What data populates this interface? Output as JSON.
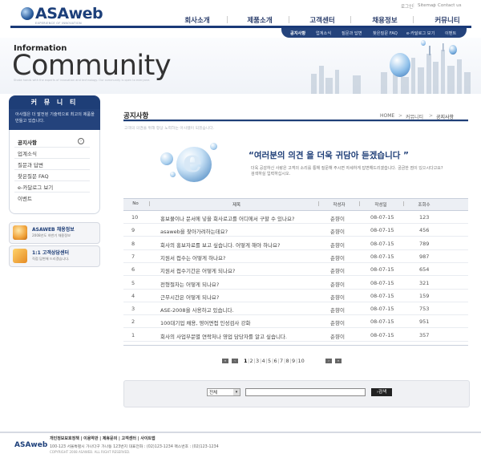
{
  "header": {
    "logo": "ASAweb",
    "logo_sub": "EXPERIENCE OF INNOVATION",
    "util": [
      "로그인",
      "Sitemap",
      "Contact us"
    ],
    "gnb": [
      "회사소개",
      "제품소개",
      "고객센터",
      "채용정보",
      "커뮤니티"
    ],
    "subnav": [
      "공지사항",
      "업계소식",
      "질문과 답변",
      "찾은질문 FAQ",
      "e-카달로그 보기",
      "이벤트"
    ]
  },
  "visual": {
    "info": "Information",
    "title": "Community",
    "desc": "Shake hands with the experts of innovation and technology. Our community is open to everyone."
  },
  "lnb": {
    "title": "커 뮤 니 티",
    "desc": "아사웹은 더 발전된 기술력으로 최고의 제품을 만들고 있습니다.",
    "items": [
      "공지사항",
      "업계소식",
      "질문과 답변",
      "찾은질문 FAQ",
      "e-카달로그 보기",
      "이벤트"
    ],
    "banners": [
      {
        "title": "ASAWEB 채용정보",
        "sub": "2008년도 하반기 채용정보"
      },
      {
        "title": "1:1 고객상담센터",
        "sub": "직접 답변해 드리겠습니다."
      }
    ]
  },
  "content": {
    "title": "공지사항",
    "breadcrumb": [
      "HOME",
      "커뮤니티",
      "공지사항"
    ],
    "desc": "고객의 의견을 위해 항상 노력하는 아사웹이 되겠습니다.",
    "quote": "“여러분의 의견 을 더욱 귀담아 듣겠습니다 ”",
    "quote_text": "더욱 공감하신 사랑은 고객의 소리를 통해 질문해 주시면 자세하게 답변해드리겠습니다. 궁금한 점이 있으시다고요? 검색하실 입력하십시오."
  },
  "table": {
    "headers": [
      "No",
      "제목",
      "작성자",
      "작성일",
      "조회수"
    ],
    "rows": [
      {
        "no": "10",
        "title": "홍보물이나 문서에 넣을 회사로고를 어디에서 구할 수 있나요?",
        "author": "춘향이",
        "date": "08-07-15",
        "views": "123"
      },
      {
        "no": "9",
        "title": "asaweb을 찾아가려하는데요?",
        "author": "춘향이",
        "date": "08-07-15",
        "views": "456"
      },
      {
        "no": "8",
        "title": "회사의 홍보자료를 보고 싶습니다. 어떻게 해야 하나요?",
        "author": "춘향이",
        "date": "08-07-15",
        "views": "789"
      },
      {
        "no": "7",
        "title": "지원서 접수는 어떻게 하나요?",
        "author": "춘향이",
        "date": "08-07-15",
        "views": "987"
      },
      {
        "no": "6",
        "title": "지원서 접수기간은 어떻게 되나요?",
        "author": "춘향이",
        "date": "08-07-15",
        "views": "654"
      },
      {
        "no": "5",
        "title": "전형절차는 어떻게 되나요?",
        "author": "춘향이",
        "date": "08-07-15",
        "views": "321"
      },
      {
        "no": "4",
        "title": "근무시간은 어떻게 되나요?",
        "author": "춘향이",
        "date": "08-07-15",
        "views": "159"
      },
      {
        "no": "3",
        "title": "ASE-2008을 사용하고 있습니다.",
        "author": "춘향이",
        "date": "08-07-15",
        "views": "753"
      },
      {
        "no": "2",
        "title": "100대기업 채용, 영어면접 인성검사 강화",
        "author": "춘향이",
        "date": "08-07-15",
        "views": "951"
      },
      {
        "no": "1",
        "title": "회사의 사업부문별 연락처나 영업 담당자를 알고 싶습니다.",
        "author": "춘향이",
        "date": "08-07-15",
        "views": "357"
      }
    ]
  },
  "pagination": {
    "pages": [
      "1",
      "2",
      "3",
      "4",
      "5",
      "6",
      "7",
      "8",
      "9",
      "10"
    ],
    "current": "1"
  },
  "search": {
    "select_value": "전체",
    "button": "검색"
  },
  "footer": {
    "logo": "ASAweb",
    "links": "개인정보보호정책 | 이용약관 | 제휴문의 | 고객센터 | 사이트맵",
    "address": "100-123 서울특별시 가나다구 가나동 123번지 대표전화 : (02)123-1234 팩스번호 : (02)123-1234",
    "copyright": "COPYRIGHT 2008 ASAWEB. ALL RIGHT RESERVED."
  },
  "colors": {
    "navy": "#1e3e77",
    "subnav": "#24437c"
  }
}
